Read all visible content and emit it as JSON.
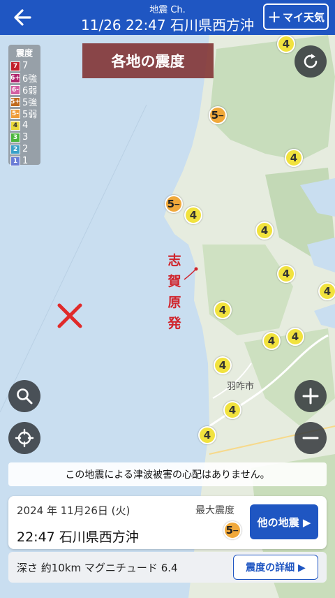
{
  "header": {
    "subtitle": "地震 Ch.",
    "title": "11/26 22:47 石川県西方沖",
    "my_weather_plus": "+",
    "my_weather_label": "マイ天気"
  },
  "map": {
    "title": "各地の震度",
    "origin_label": "志賀原発",
    "city_label": "羽咋市"
  },
  "legend": {
    "title": "震度",
    "items": [
      {
        "chip": "7",
        "label": "7",
        "color": "#c21f2a"
      },
      {
        "chip": "6+",
        "label": "6強",
        "color": "#b0246d"
      },
      {
        "chip": "6-",
        "label": "6弱",
        "color": "#d35fa2"
      },
      {
        "chip": "5+",
        "label": "5強",
        "color": "#c06a1d"
      },
      {
        "chip": "5-",
        "label": "5弱",
        "color": "#ef9c3a"
      },
      {
        "chip": "4",
        "label": "4",
        "color": "#e9d83b"
      },
      {
        "chip": "3",
        "label": "3",
        "color": "#4bb63e"
      },
      {
        "chip": "2",
        "label": "2",
        "color": "#3ba0c8"
      },
      {
        "chip": "1",
        "label": "1",
        "color": "#6b7dd6"
      }
    ]
  },
  "markers": {
    "four": "4",
    "five_lower": "5",
    "five_lower_suffix": "−"
  },
  "tsunami_notice": "この地震による津波被害の心配はありません。",
  "info": {
    "date": "2024 年 11月26日 (火)",
    "time_place": "22:47 石川県西方沖",
    "max_intensity_label": "最大震度",
    "other_button": "他の地震 ▶",
    "detail_text": "深さ 約10km マグニチュード 6.4",
    "detail_button": "震度の詳細 ▶"
  }
}
